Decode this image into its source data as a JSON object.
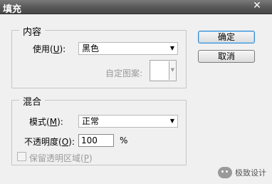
{
  "window": {
    "title": "填充",
    "close_glyph": "✕"
  },
  "content_group": {
    "legend": "内容",
    "use_label": "使用",
    "use_mnemonic": "U",
    "use_value": "黑色",
    "custom_pattern_label": "自定图案:"
  },
  "blend_group": {
    "legend": "混合",
    "mode_label": "模式",
    "mode_mnemonic": "M",
    "mode_value": "正常",
    "opacity_label": "不透明度",
    "opacity_mnemonic": "O",
    "opacity_value": "100",
    "opacity_unit": "%",
    "preserve_label": "保留透明区域",
    "preserve_mnemonic": "P",
    "preserve_checked": false
  },
  "buttons": {
    "ok": "确定",
    "cancel": "取消"
  },
  "watermark": {
    "text": "极致设计"
  }
}
